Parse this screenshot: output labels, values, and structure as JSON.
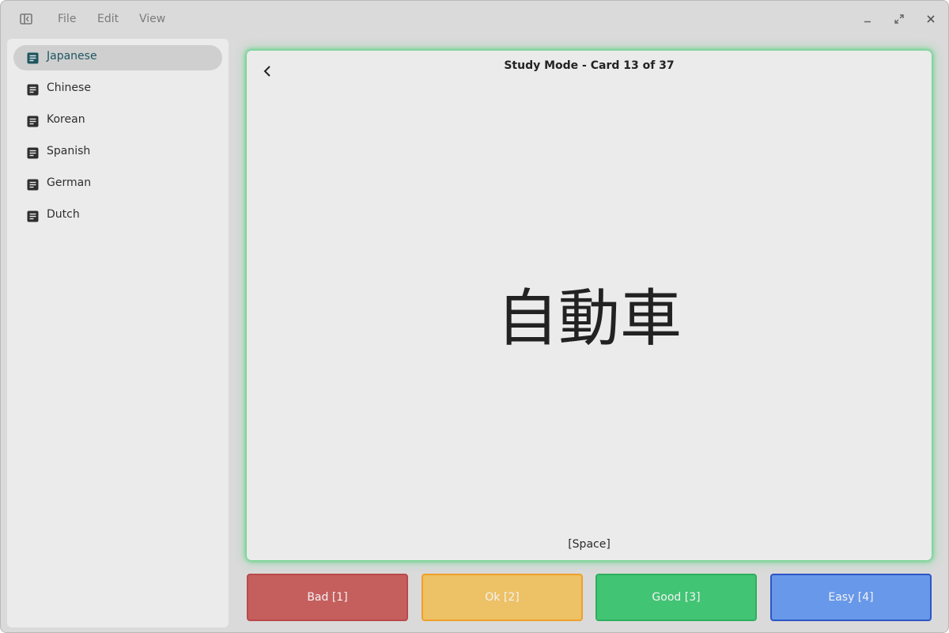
{
  "menu": {
    "file": "File",
    "edit": "Edit",
    "view": "View"
  },
  "sidebar": {
    "items": [
      {
        "label": "Japanese",
        "icon": "document-icon",
        "active": true
      },
      {
        "label": "Chinese",
        "icon": "document-icon"
      },
      {
        "label": "Korean",
        "icon": "document-icon"
      },
      {
        "label": "Spanish",
        "icon": "document-icon"
      },
      {
        "label": "German",
        "icon": "document-icon"
      },
      {
        "label": "Dutch",
        "icon": "document-icon"
      }
    ]
  },
  "card": {
    "title": "Study Mode - Card 13 of 37",
    "word": "自動車",
    "hint": "[Space]"
  },
  "ratings": [
    {
      "label": "Bad [1]",
      "bg": "#c55f5e",
      "border": "#b84a4a"
    },
    {
      "label": "Ok [2]",
      "bg": "#edc166",
      "border": "#f0a02a"
    },
    {
      "label": "Good [3]",
      "bg": "#41c474",
      "border": "#2fae5e"
    },
    {
      "label": "Easy [4]",
      "bg": "#6898ea",
      "border": "#2d55c5"
    }
  ],
  "colors": {
    "accent_active_text": "#1e5560",
    "card_glow": "#5ad282"
  }
}
